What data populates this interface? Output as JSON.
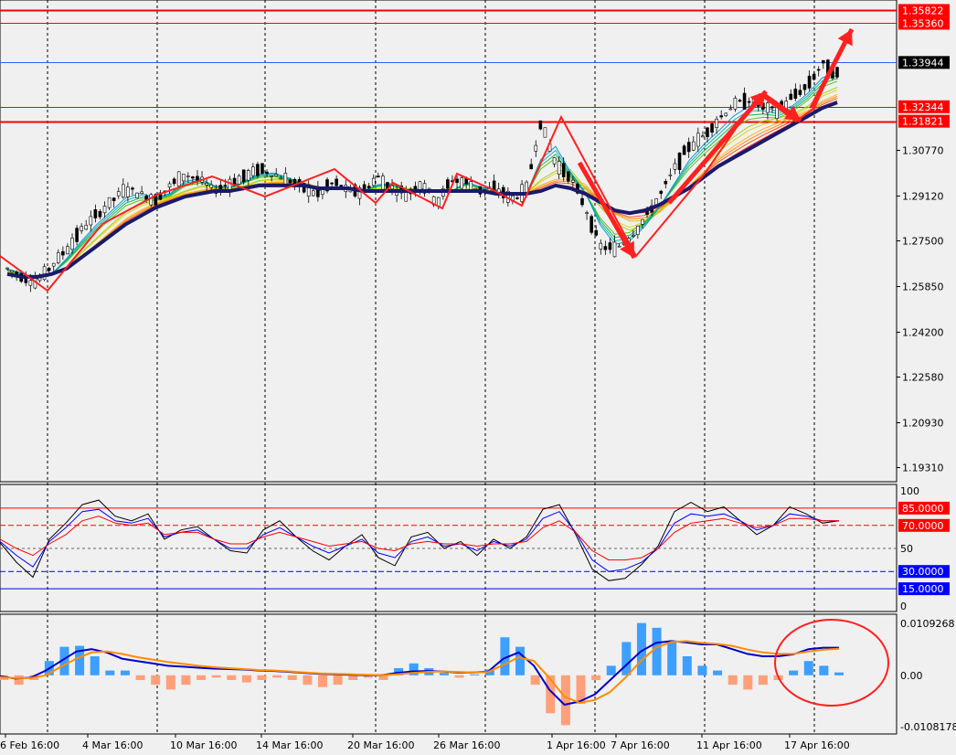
{
  "colors": {
    "background": "#f0f0f0",
    "resistance_line": "#ff0000",
    "current_price_line": "#3060ff",
    "slow_ma": "#1a1a6b",
    "annotation_arrow": "#ff2020",
    "stoch_main": "#000000",
    "stoch_signal_1": "#0000ff",
    "stoch_signal_2": "#ff0000",
    "macd_line": "#0000c8",
    "signal_line": "#ff8c00",
    "hist_positive": "#3d9fff",
    "hist_negative": "#ffa07a",
    "circle": "#ff2020"
  },
  "chart_data": [
    {
      "type": "line",
      "panel": "price",
      "ylim": [
        1.188,
        1.362
      ],
      "y_ticks": [
        "1.30770",
        "1.29120",
        "1.27500",
        "1.25850",
        "1.24200",
        "1.22580",
        "1.20930",
        "1.19310"
      ],
      "levels": [
        {
          "label": "1.35822",
          "value": 1.35822,
          "color": "#ff0000"
        },
        {
          "label": "1.35360",
          "value": 1.3536,
          "color": "#ff0000"
        },
        {
          "label": "1.33944",
          "value": 1.33944,
          "color": "#000000"
        },
        {
          "label": "1.32344",
          "value": 1.32344,
          "color": "#ff0000"
        },
        {
          "label": "1.31821",
          "value": 1.31821,
          "color": "#ff0000"
        }
      ],
      "series_price": [
        1.265,
        1.262,
        1.26,
        1.266,
        1.272,
        1.279,
        1.284,
        1.289,
        1.294,
        1.292,
        1.29,
        1.295,
        1.299,
        1.297,
        1.293,
        1.296,
        1.298,
        1.301,
        1.299,
        1.297,
        1.294,
        1.292,
        1.296,
        1.293,
        1.293,
        1.298,
        1.294,
        1.292,
        1.296,
        1.289,
        1.297,
        1.296,
        1.293,
        1.294,
        1.29,
        1.293,
        1.318,
        1.303,
        1.298,
        1.287,
        1.273,
        1.272,
        1.276,
        1.283,
        1.291,
        1.301,
        1.309,
        1.313,
        1.319,
        1.324,
        1.326,
        1.323,
        1.322,
        1.327,
        1.331,
        1.339,
        1.335
      ],
      "series_slow_ma": [
        1.263,
        1.262,
        1.262,
        1.263,
        1.265,
        1.269,
        1.273,
        1.277,
        1.281,
        1.284,
        1.287,
        1.289,
        1.291,
        1.292,
        1.293,
        1.293,
        1.294,
        1.295,
        1.295,
        1.295,
        1.295,
        1.294,
        1.294,
        1.294,
        1.293,
        1.293,
        1.293,
        1.293,
        1.293,
        1.293,
        1.293,
        1.293,
        1.293,
        1.292,
        1.292,
        1.292,
        1.293,
        1.295,
        1.294,
        1.292,
        1.289,
        1.286,
        1.285,
        1.286,
        1.288,
        1.291,
        1.294,
        1.298,
        1.302,
        1.305,
        1.308,
        1.311,
        1.314,
        1.317,
        1.32,
        1.323,
        1.325
      ]
    },
    {
      "type": "line",
      "panel": "stochastic",
      "ylim": [
        0,
        100
      ],
      "y_ticks": [
        "100",
        "50",
        "0"
      ],
      "levels": [
        {
          "label": "85.0000",
          "value": 85,
          "color": "#ff0000"
        },
        {
          "label": "70.0000",
          "value": 70,
          "color": "#ff0000"
        },
        {
          "label": "30.0000",
          "value": 30,
          "color": "#0000ff"
        },
        {
          "label": "15.0000",
          "value": 15,
          "color": "#0000ff"
        }
      ],
      "series": [
        {
          "values": [
            55,
            38,
            25,
            58,
            72,
            88,
            92,
            78,
            74,
            80,
            58,
            66,
            69,
            58,
            48,
            46,
            66,
            74,
            60,
            48,
            40,
            52,
            62,
            42,
            35,
            60,
            64,
            50,
            56,
            44,
            58,
            50,
            60,
            84,
            88,
            62,
            32,
            22,
            24,
            36,
            52,
            82,
            90,
            82,
            86,
            74,
            62,
            70,
            86,
            80,
            72,
            74
          ]
        },
        {
          "values": [
            56,
            44,
            34,
            56,
            68,
            82,
            84,
            74,
            72,
            76,
            60,
            64,
            66,
            58,
            50,
            50,
            62,
            68,
            60,
            52,
            46,
            52,
            58,
            46,
            42,
            56,
            60,
            52,
            54,
            48,
            56,
            52,
            58,
            76,
            82,
            64,
            40,
            30,
            32,
            38,
            50,
            72,
            80,
            78,
            80,
            74,
            66,
            70,
            80,
            78,
            74,
            74
          ]
        },
        {
          "values": [
            58,
            50,
            44,
            54,
            62,
            74,
            78,
            72,
            70,
            72,
            62,
            64,
            64,
            58,
            54,
            54,
            60,
            64,
            60,
            56,
            52,
            54,
            56,
            50,
            48,
            54,
            56,
            54,
            54,
            52,
            54,
            54,
            56,
            68,
            74,
            64,
            48,
            40,
            40,
            42,
            50,
            64,
            72,
            74,
            76,
            72,
            68,
            70,
            76,
            76,
            74,
            74
          ]
        }
      ]
    },
    {
      "type": "bar",
      "panel": "macd",
      "ylim": [
        -0.0108178,
        0.0109268
      ],
      "y_ticks": [
        "0.0109268",
        "0.00",
        "-0.0108178"
      ],
      "histogram": [
        -0.001,
        -0.002,
        -0.001,
        0.003,
        0.006,
        0.0062,
        0.004,
        0.001,
        0.001,
        -0.001,
        -0.002,
        -0.003,
        -0.002,
        -0.001,
        -0.0005,
        -0.001,
        -0.0015,
        -0.001,
        -0.0005,
        -0.001,
        -0.002,
        -0.0025,
        -0.002,
        -0.001,
        -0.0005,
        -0.001,
        0.0015,
        0.0025,
        0.0015,
        0.0005,
        -0.0005,
        0.0002,
        0.0012,
        0.008,
        0.006,
        -0.002,
        -0.008,
        -0.0105,
        -0.006,
        -0.001,
        0.002,
        0.007,
        0.011,
        0.01,
        0.007,
        0.004,
        0.002,
        0.001,
        -0.002,
        -0.003,
        -0.002,
        -0.001,
        0.001,
        0.003,
        0.002,
        0.0006
      ],
      "series": [
        {
          "values": [
            -0.0002,
            -0.0007,
            -0.0005,
            0.001,
            0.003,
            0.005,
            0.0055,
            0.0048,
            0.0035,
            0.003,
            0.0025,
            0.002,
            0.0018,
            0.0016,
            0.0014,
            0.0013,
            0.0012,
            0.001,
            0.0009,
            0.0007,
            0.0005,
            0.0003,
            0.0002,
            0.0001,
            0.0,
            0.0,
            0.0005,
            0.0008,
            0.0009,
            0.0008,
            0.0006,
            0.0006,
            0.0008,
            0.0035,
            0.0048,
            0.002,
            -0.003,
            -0.0062,
            -0.0055,
            -0.004,
            -0.001,
            0.002,
            0.005,
            0.0068,
            0.0072,
            0.0069,
            0.0065,
            0.0065,
            0.0055,
            0.0045,
            0.004,
            0.004,
            0.0044,
            0.0055,
            0.0058,
            0.0058
          ]
        },
        {
          "values": [
            -0.0004,
            -0.0006,
            -0.0006,
            0.0,
            0.0018,
            0.0035,
            0.0048,
            0.005,
            0.0045,
            0.0038,
            0.0033,
            0.0028,
            0.0024,
            0.002,
            0.0017,
            0.0015,
            0.0013,
            0.0011,
            0.001,
            0.0008,
            0.0006,
            0.0004,
            0.0003,
            0.0002,
            0.0001,
            0.0,
            0.0002,
            0.0005,
            0.0007,
            0.0008,
            0.0007,
            0.0006,
            0.0007,
            0.0022,
            0.0038,
            0.003,
            -0.0005,
            -0.0045,
            -0.0058,
            -0.0052,
            -0.0035,
            -0.0005,
            0.003,
            0.0058,
            0.007,
            0.0072,
            0.0068,
            0.0066,
            0.0062,
            0.0054,
            0.0048,
            0.0045,
            0.0045,
            0.005,
            0.0054,
            0.0056
          ]
        }
      ]
    }
  ],
  "x_labels": [
    "6 Feb 16:00",
    "4 Mar 16:00",
    "10 Mar 16:00",
    "14 Mar 16:00",
    "20 Mar 16:00",
    "26 Mar 16:00",
    "1 Apr 16:00",
    "7 Apr 16:00",
    "11 Apr 16:00",
    "17 Apr 16:00"
  ]
}
